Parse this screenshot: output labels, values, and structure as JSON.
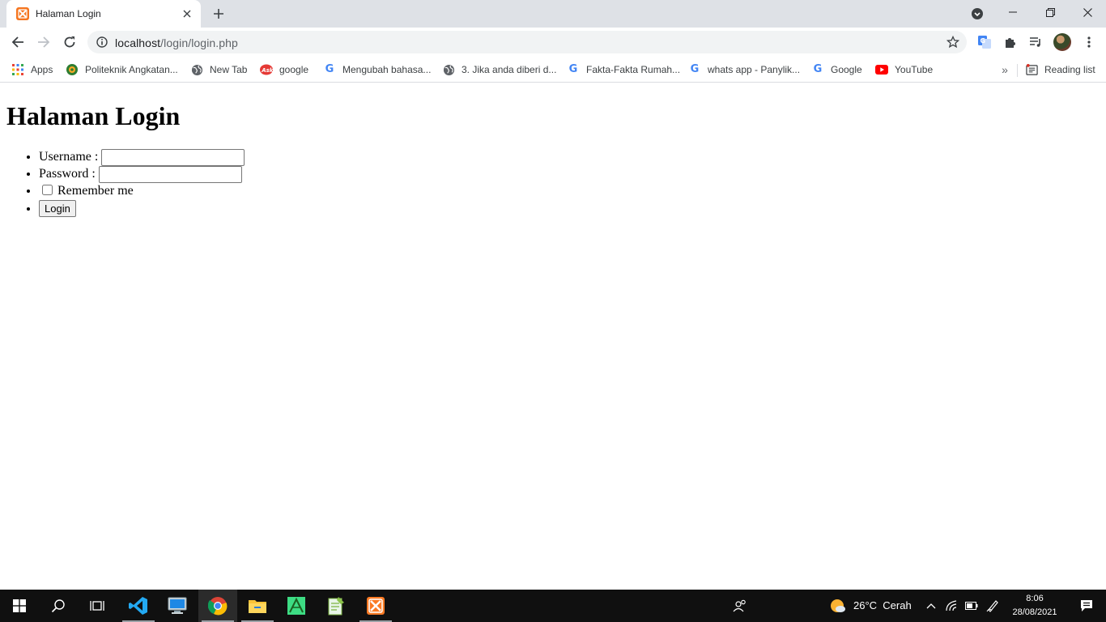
{
  "browser": {
    "tab": {
      "title": "Halaman Login"
    },
    "address": {
      "host": "localhost",
      "path": "/login/login.php"
    },
    "bookmarks": [
      {
        "label": "Apps",
        "icon": "apps-grid-icon"
      },
      {
        "label": "Politeknik Angkatan...",
        "icon": "emblem-icon"
      },
      {
        "label": "New Tab",
        "icon": "globe-icon"
      },
      {
        "label": "google",
        "icon": "ask-icon"
      },
      {
        "label": "Mengubah bahasa...",
        "icon": "google-icon"
      },
      {
        "label": "3. Jika anda diberi d...",
        "icon": "globe-icon"
      },
      {
        "label": "Fakta-Fakta Rumah...",
        "icon": "google-icon"
      },
      {
        "label": "whats app - Panylik...",
        "icon": "google-icon"
      },
      {
        "label": "Google",
        "icon": "google-icon"
      },
      {
        "label": "YouTube",
        "icon": "youtube-icon"
      }
    ],
    "reading_list": "Reading list"
  },
  "page": {
    "heading": "Halaman Login",
    "username_label": "Username :",
    "username_value": "",
    "password_label": "Password :",
    "password_value": "",
    "remember_label": "Remember me",
    "remember_checked": false,
    "login_button": "Login"
  },
  "taskbar": {
    "weather": {
      "temp": "26°C",
      "condition": "Cerah"
    },
    "time": "8:06",
    "date": "28/08/2021"
  },
  "colors": {
    "tab_strip": "#dee1e6",
    "omnibox": "#f1f3f4",
    "taskbar": "#101010",
    "xampp_orange": "#f5751f",
    "youtube_red": "#ff0000"
  }
}
